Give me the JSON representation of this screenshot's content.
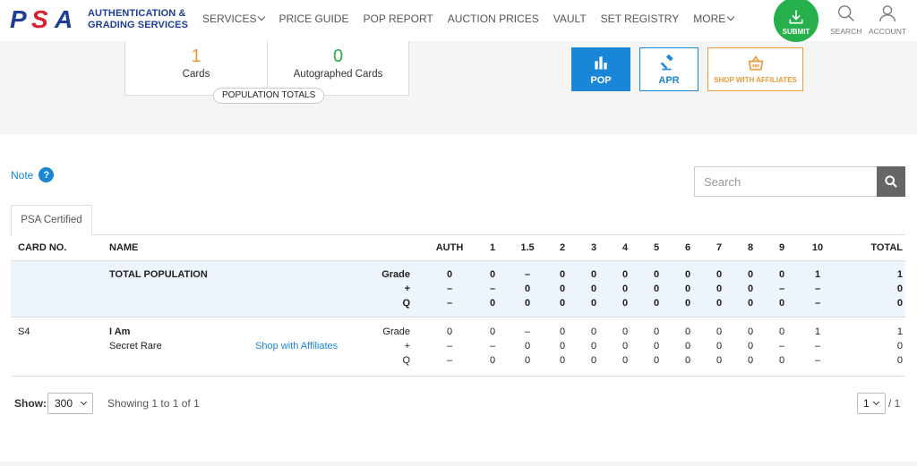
{
  "header": {
    "logo_mark": "PSA",
    "logo_line1": "AUTHENTICATION &",
    "logo_line2": "GRADING SERVICES",
    "nav": [
      "SERVICES",
      "PRICE GUIDE",
      "POP REPORT",
      "AUCTION PRICES",
      "VAULT",
      "SET REGISTRY",
      "MORE"
    ],
    "submit_label": "SUBMIT",
    "search_label": "SEARCH",
    "account_label": "ACCOUNT",
    "submit_color": "#25b04b"
  },
  "stats": {
    "cards_count": "1",
    "cards_label": "Cards",
    "autographed_count": "0",
    "autographed_label": "Autographed Cards",
    "totals_label": "POPULATION TOTALS"
  },
  "actions": {
    "pop_label": "POP",
    "apr_label": "APR",
    "shop_label": "SHOP WITH AFFILIATES"
  },
  "note_label": "Note",
  "note_icon": "?",
  "search": {
    "placeholder": "Search"
  },
  "tab_label": "PSA Certified",
  "table": {
    "headers": {
      "card_no": "CARD NO.",
      "name": "NAME",
      "grades": [
        "AUTH",
        "1",
        "1.5",
        "2",
        "3",
        "4",
        "5",
        "6",
        "7",
        "8",
        "9",
        "10",
        "TOTAL"
      ]
    },
    "total_row": {
      "name": "TOTAL POPULATION",
      "row_labels": [
        "Grade",
        "+",
        "Q"
      ],
      "values": [
        [
          "0",
          "0",
          "–",
          "0",
          "0",
          "0",
          "0",
          "0",
          "0",
          "0",
          "0",
          "1",
          "1"
        ],
        [
          "–",
          "–",
          "0",
          "0",
          "0",
          "0",
          "0",
          "0",
          "0",
          "0",
          "–",
          "–",
          "0"
        ],
        [
          "–",
          "0",
          "0",
          "0",
          "0",
          "0",
          "0",
          "0",
          "0",
          "0",
          "0",
          "–",
          "0"
        ]
      ]
    },
    "card_row": {
      "card_no": "S4",
      "name": "I Am",
      "variant": "Secret Rare",
      "shop_link": "Shop with Affiliates",
      "row_labels": [
        "Grade",
        "+",
        "Q"
      ],
      "values": [
        [
          "0",
          "0",
          "–",
          "0",
          "0",
          "0",
          "0",
          "0",
          "0",
          "0",
          "0",
          "1",
          "1"
        ],
        [
          "–",
          "–",
          "0",
          "0",
          "0",
          "0",
          "0",
          "0",
          "0",
          "0",
          "–",
          "–",
          "0"
        ],
        [
          "–",
          "0",
          "0",
          "0",
          "0",
          "0",
          "0",
          "0",
          "0",
          "0",
          "0",
          "–",
          "0"
        ]
      ]
    }
  },
  "footer": {
    "show_label": "Show:",
    "show_value": "300",
    "showing_text": "Showing 1 to 1 of 1",
    "page_value": "1",
    "page_total": "/ 1"
  }
}
